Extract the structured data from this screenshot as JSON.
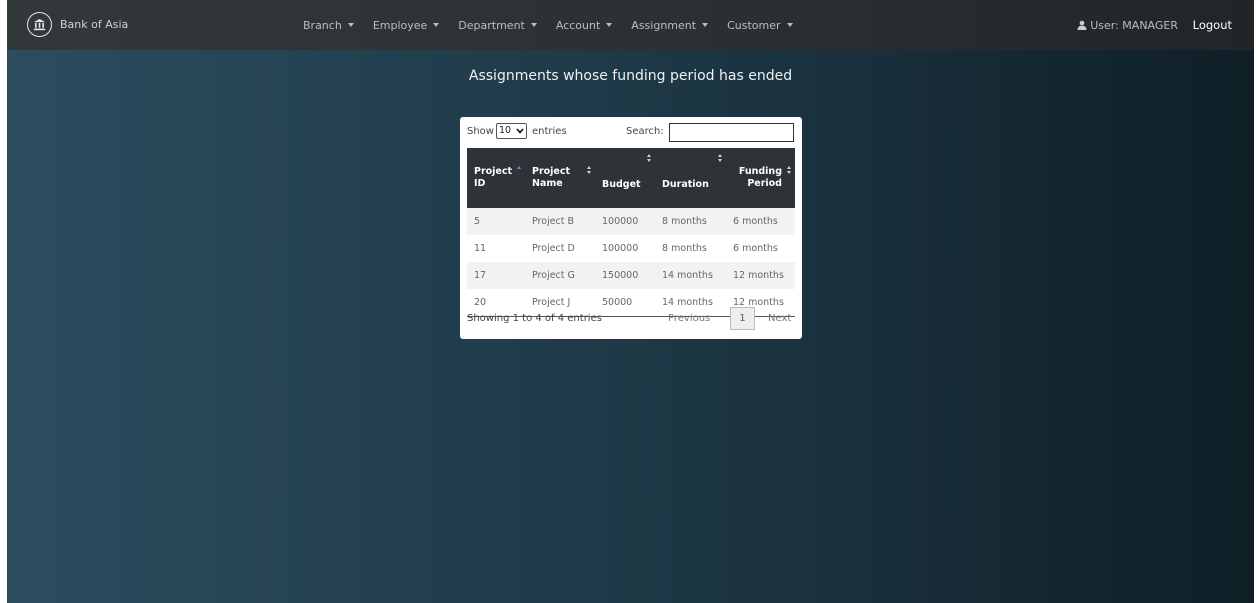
{
  "navbar": {
    "brand": "Bank of Asia",
    "menu": [
      "Branch",
      "Employee",
      "Department",
      "Account",
      "Assignment",
      "Customer"
    ],
    "user_label": "User: MANAGER",
    "logout_label": "Logout"
  },
  "page": {
    "title": "Assignments whose funding period has ended"
  },
  "table_controls": {
    "show_label": "Show",
    "entries_value": "10",
    "entries_label": "entries",
    "search_label": "Search:",
    "search_value": ""
  },
  "table": {
    "headers": [
      "Project ID",
      "Project Name",
      "Budget",
      "Duration",
      "Funding Period"
    ],
    "sorted_column": "Project ID",
    "rows": [
      [
        "5",
        "Project B",
        "100000",
        "8 months",
        "6 months"
      ],
      [
        "11",
        "Project D",
        "100000",
        "8 months",
        "6 months"
      ],
      [
        "17",
        "Project G",
        "150000",
        "14 months",
        "12 months"
      ],
      [
        "20",
        "Project J",
        "50000",
        "14 months",
        "12 months"
      ]
    ]
  },
  "pagination": {
    "info": "Showing 1 to 4 of 4 entries",
    "previous_label": "Previous",
    "current_page": "1",
    "next_label": "Next"
  },
  "colors": {
    "navbar": "#2e3336",
    "background_left": "#2b4d5e",
    "background_right": "#0f1f26",
    "table_header": "#2e3337"
  },
  "icons": {
    "brand": "bank-icon",
    "user": "user-icon"
  }
}
